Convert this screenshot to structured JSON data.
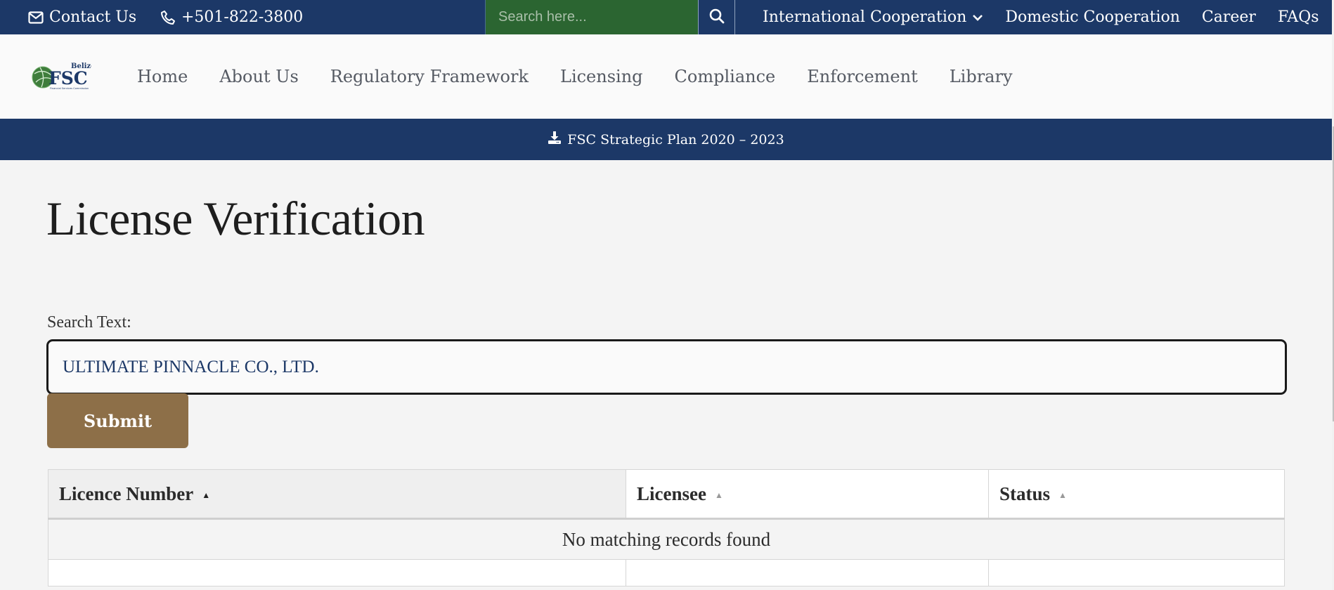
{
  "topbar": {
    "contact_label": "Contact Us",
    "contact_icon": "envelope-icon",
    "phone_label": "+501-822-3800",
    "phone_icon": "phone-icon",
    "search_placeholder": "Search here...",
    "search_icon": "search-icon",
    "links": [
      {
        "label": "International Cooperation",
        "has_dropdown": true
      },
      {
        "label": "Domestic Cooperation"
      },
      {
        "label": "Career"
      },
      {
        "label": "FAQs"
      }
    ]
  },
  "logo": {
    "top_text": "Belize",
    "main_text": "FSC",
    "sub_text": "Financial Services Commission"
  },
  "mainnav": {
    "items": [
      "Home",
      "About Us",
      "Regulatory Framework",
      "Licensing",
      "Compliance",
      "Enforcement",
      "Library"
    ]
  },
  "banner": {
    "icon": "download-icon",
    "label": "FSC Strategic Plan 2020 – 2023"
  },
  "page": {
    "title": "License Verification",
    "search_label": "Search Text:",
    "search_value": "ULTIMATE PINNACLE CO., LTD.",
    "submit_label": "Submit"
  },
  "table": {
    "columns": [
      {
        "label": "Licence Number",
        "sort": "ascending",
        "active": true
      },
      {
        "label": "Licensee",
        "sort": "ascending",
        "active": false
      },
      {
        "label": "Status",
        "sort": "ascending",
        "active": false
      }
    ],
    "empty_message": "No matching records found"
  },
  "colors": {
    "navy": "#1c3867",
    "search_green": "#2b6531",
    "submit_brown": "#8d6f48"
  }
}
